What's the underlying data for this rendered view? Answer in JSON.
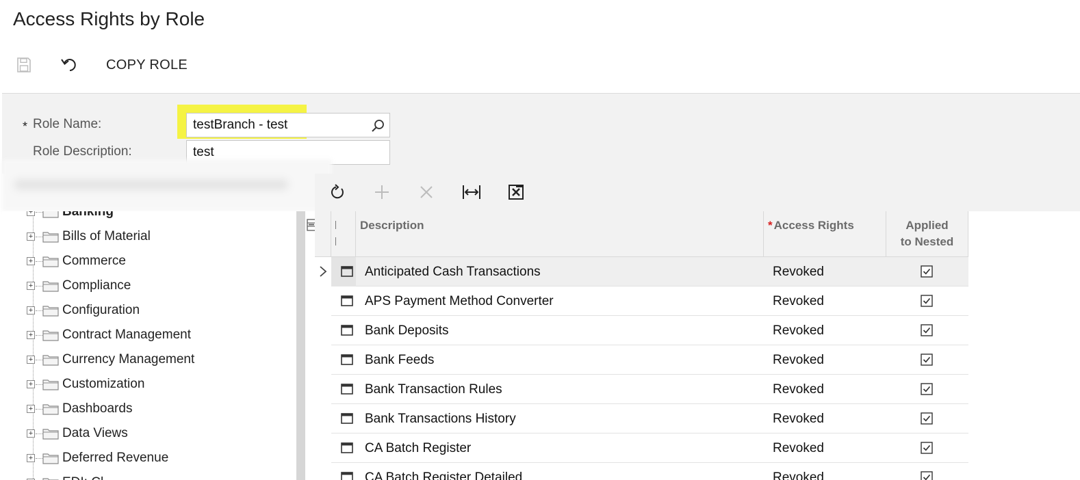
{
  "page": {
    "title": "Access Rights by Role"
  },
  "toolbar": {
    "save_icon": "save-icon",
    "undo_icon": "undo-icon",
    "copy_role_label": "COPY ROLE"
  },
  "form": {
    "role_name_required": "*",
    "role_name_label": "Role Name:",
    "role_name_value": "testBranch - test",
    "role_description_label": "Role Description:",
    "role_description_value": "test",
    "highlight_color": "#f5f200"
  },
  "grid_toolbar": {
    "icons": [
      "refresh-icon",
      "add-icon",
      "delete-icon",
      "fit-columns-icon",
      "export-excel-icon"
    ]
  },
  "tree": {
    "items": [
      {
        "label": "Banking",
        "bold": true
      },
      {
        "label": "Bills of Material"
      },
      {
        "label": "Commerce"
      },
      {
        "label": "Compliance"
      },
      {
        "label": "Configuration"
      },
      {
        "label": "Contract Management"
      },
      {
        "label": "Currency Management"
      },
      {
        "label": "Customization"
      },
      {
        "label": "Dashboards"
      },
      {
        "label": "Data Views"
      },
      {
        "label": "Deferred Revenue"
      },
      {
        "label": "EDI: Cl..."
      }
    ]
  },
  "grid": {
    "columns": {
      "description": "Description",
      "access_rights_required": "*",
      "access_rights": "Access Rights",
      "applied_line1": "Applied",
      "applied_line2": "to Nested"
    },
    "rows": [
      {
        "description": "Anticipated Cash Transactions",
        "access_rights": "Revoked",
        "applied": true
      },
      {
        "description": "APS Payment Method Converter",
        "access_rights": "Revoked",
        "applied": true
      },
      {
        "description": "Bank Deposits",
        "access_rights": "Revoked",
        "applied": true
      },
      {
        "description": "Bank Feeds",
        "access_rights": "Revoked",
        "applied": true
      },
      {
        "description": "Bank Transaction Rules",
        "access_rights": "Revoked",
        "applied": true
      },
      {
        "description": "Bank Transactions History",
        "access_rights": "Revoked",
        "applied": true
      },
      {
        "description": "CA Batch Register",
        "access_rights": "Revoked",
        "applied": true
      },
      {
        "description": "CA Batch Register Detailed",
        "access_rights": "Revoked",
        "applied": true
      }
    ]
  }
}
